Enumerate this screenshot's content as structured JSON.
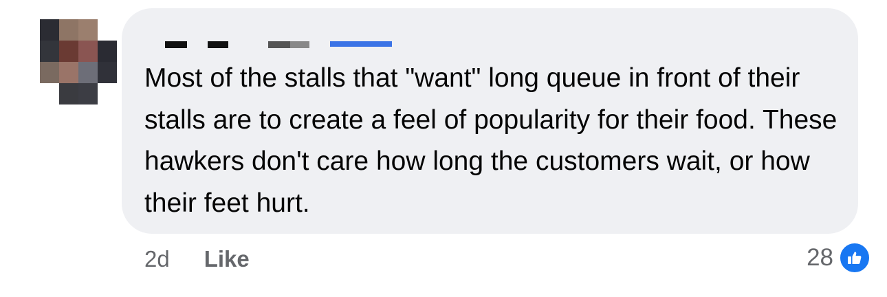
{
  "comment": {
    "text": "Most of the stalls that \"want\" long queue in front of their stalls are to create a feel of popularity for their food. These hawkers don't care how long the customers wait, or how their feet hurt.",
    "timestamp": "2d",
    "like_label": "Like",
    "reaction_count": "28",
    "reaction_icon": "thumbs-up-icon"
  },
  "colors": {
    "bubble": "#eff0f3",
    "text": "#050505",
    "meta": "#65676b",
    "like_blue": "#1877f2"
  }
}
